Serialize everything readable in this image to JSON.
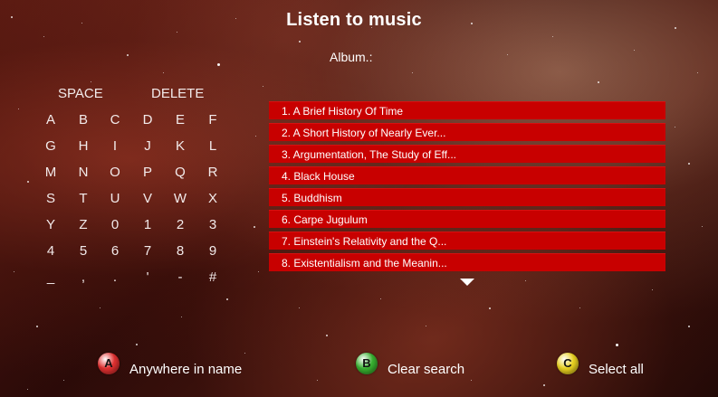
{
  "header": {
    "title": "Listen to music",
    "album_label": "Album.:"
  },
  "keyboard": {
    "space_label": "SPACE",
    "delete_label": "DELETE",
    "rows": [
      [
        "A",
        "B",
        "C",
        "D",
        "E",
        "F"
      ],
      [
        "G",
        "H",
        "I",
        "J",
        "K",
        "L"
      ],
      [
        "M",
        "N",
        "O",
        "P",
        "Q",
        "R"
      ],
      [
        "S",
        "T",
        "U",
        "V",
        "W",
        "X"
      ],
      [
        "Y",
        "Z",
        "0",
        "1",
        "2",
        "3"
      ],
      [
        "4",
        "5",
        "6",
        "7",
        "8",
        "9"
      ],
      [
        "_",
        ",",
        ".",
        "'",
        "-",
        "#"
      ]
    ]
  },
  "albums": [
    "1. A Brief History Of Time",
    "2. A Short History of Nearly Ever...",
    "3. Argumentation, The Study of Eff...",
    "4. Black House",
    "5. Buddhism",
    "6. Carpe Jugulum",
    "7. Einstein's Relativity and the Q...",
    "8. Existentialism and the Meanin..."
  ],
  "hints": [
    {
      "button": "A",
      "label": "Anywhere in name",
      "color": "#e03030"
    },
    {
      "button": "B",
      "label": "Clear search",
      "color": "#38b030"
    },
    {
      "button": "C",
      "label": "Select all",
      "color": "#e8d020"
    }
  ],
  "icons": {
    "scroll": "scroll-down-arrow-icon"
  },
  "colors": {
    "list_row": "#c80000"
  }
}
